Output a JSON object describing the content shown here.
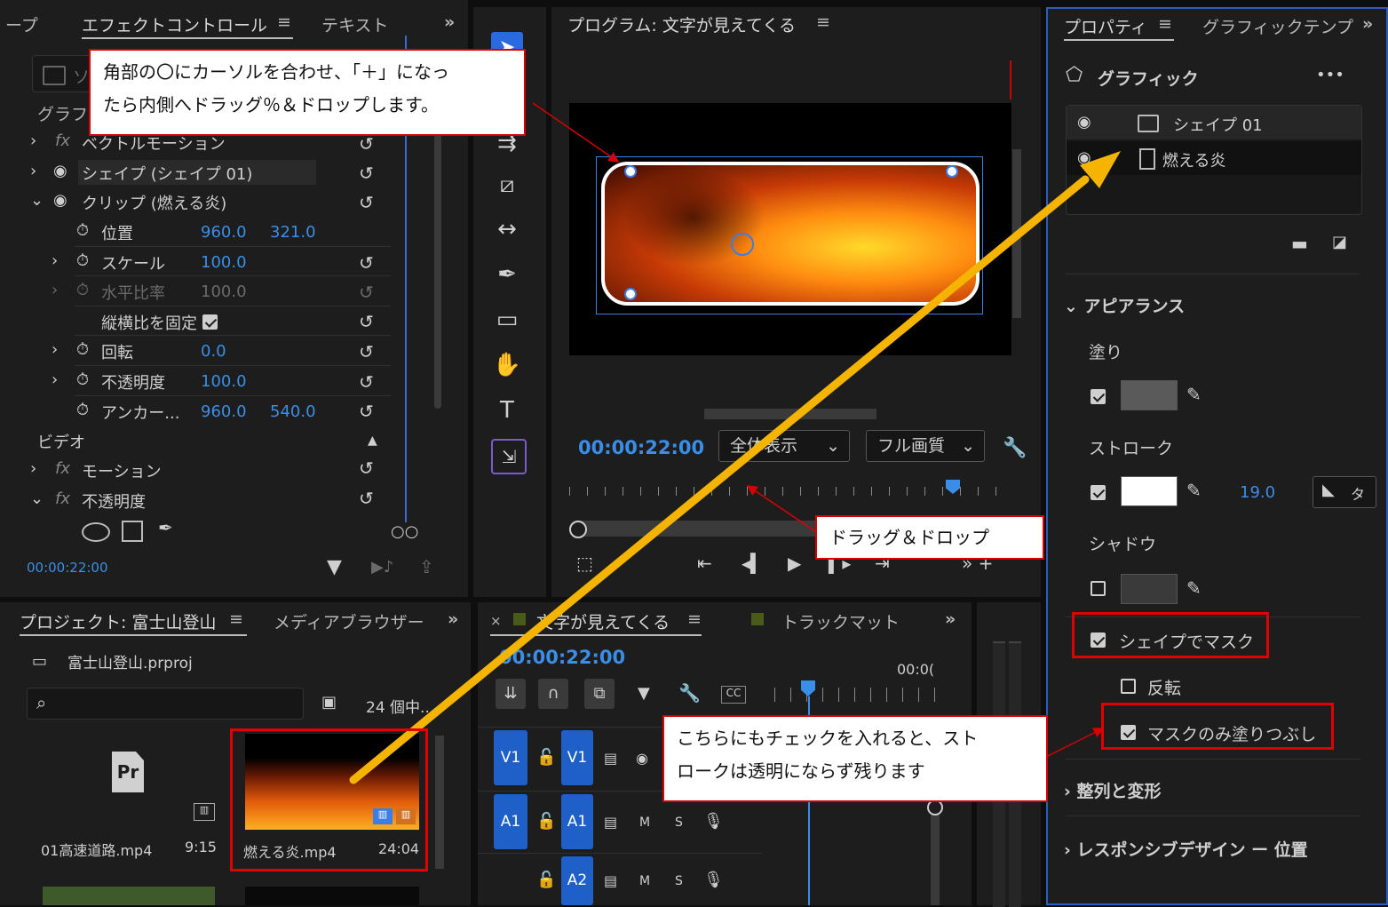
{
  "effect_controls": {
    "tabs": [
      "ープ",
      "エフェクトコントロール",
      "テキスト"
    ],
    "search_placeholder": "ソ",
    "graphic_label": "グラフィ",
    "rows": [
      {
        "label": "ベクトルモーション"
      },
      {
        "label": "シェイプ (シェイプ 01)"
      },
      {
        "label": "クリップ (燃える炎)"
      },
      {
        "label": "位置",
        "v1": "960.0",
        "v2": "321.0"
      },
      {
        "label": "スケール",
        "v1": "100.0"
      },
      {
        "label": "水平比率",
        "v1": "100.0"
      },
      {
        "label": "縦横比を固定"
      },
      {
        "label": "回転",
        "v1": "0.0"
      },
      {
        "label": "不透明度",
        "v1": "100.0"
      },
      {
        "label": "アンカー...",
        "v1": "960.0",
        "v2": "540.0"
      }
    ],
    "video_section": "ビデオ",
    "video_rows": [
      {
        "label": "モーション"
      },
      {
        "label": "不透明度"
      }
    ],
    "timecode": "00:00:22:00"
  },
  "program": {
    "title": "プログラム: 文字が見えてくる",
    "timecode": "00:00:22:00",
    "fit": "全体表示",
    "quality": "フル画質"
  },
  "properties": {
    "tabs": [
      "プロパティ",
      "グラフィックテンプ"
    ],
    "graphic_title": "グラフィック",
    "more": "•••",
    "layers": [
      {
        "name": "シェイプ 01"
      },
      {
        "name": "燃える炎"
      }
    ],
    "appearance": "アピアランス",
    "fill": "塗り",
    "stroke": "ストローク",
    "stroke_width": "19.0",
    "stroke_join_label": "タ",
    "shadow": "シャドウ",
    "mask_with_shape": "シェイプでマスク",
    "invert": "反転",
    "fill_mask_only": "マスクのみ塗りつぶし",
    "align_transform": "整列と変形",
    "responsive": "レスポンシブデザイン ー 位置",
    "colors": {
      "fill": "#5a5a5a",
      "stroke": "#ffffff",
      "shadow": "#3a3a3a"
    }
  },
  "project": {
    "tabs": [
      "プロジェクト: 富士山登山",
      "メディアブラウザー"
    ],
    "file": "富士山登山.prproj",
    "count": "24 個中...",
    "items": [
      {
        "name": "01高速道路.mp4",
        "duration": "9:15"
      },
      {
        "name": "燃える炎.mp4",
        "duration": "24:04"
      }
    ]
  },
  "timeline": {
    "tabs": [
      "文字が見えてくる",
      "トラックマット"
    ],
    "timecode": "00:00:22:00",
    "ruler_label": "00:0(",
    "tracks": [
      {
        "src": "V1",
        "dst": "V1"
      },
      {
        "src": "A1",
        "dst": "A1",
        "m": "M",
        "s": "S"
      },
      {
        "dst": "A2",
        "m": "M",
        "s": "S"
      }
    ]
  },
  "callouts": {
    "corner": [
      "角部の〇にカーソルを合わせ、「＋」になっ",
      "たら内側へドラッグ％＆ドロップします。"
    ],
    "drag": "ドラッグ＆ドロップ",
    "check": [
      "こちらにもチェックを入れると、スト",
      "ロークは透明にならず残ります"
    ]
  }
}
